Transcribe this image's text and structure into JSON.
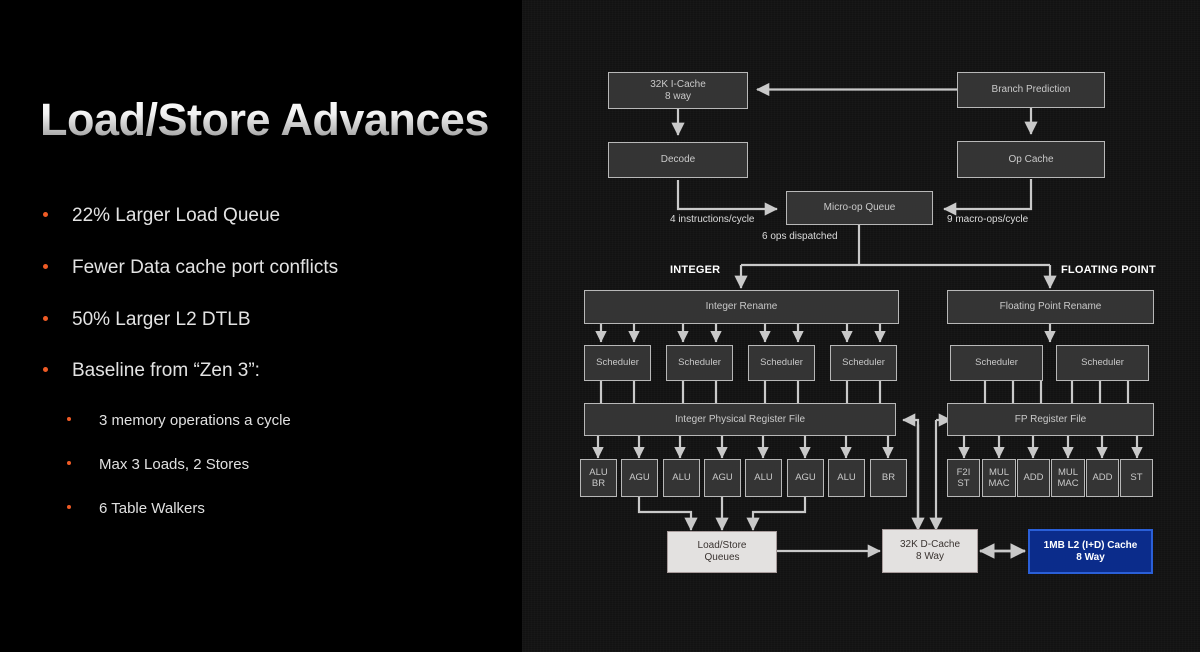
{
  "slide": {
    "title": "Load/Store Advances",
    "accent_color": "#ef5b25",
    "background_left": "#000000",
    "background_right": "#121212"
  },
  "bullets": [
    {
      "level": 1,
      "text": "22% Larger Load Queue"
    },
    {
      "level": 1,
      "text": "Fewer Data cache port conflicts"
    },
    {
      "level": 1,
      "text": "50% Larger L2 DTLB"
    },
    {
      "level": 1,
      "text": "Baseline from “Zen 3”:"
    },
    {
      "level": 2,
      "text": "3 memory operations a cycle"
    },
    {
      "level": 2,
      "text": "Max 3 Loads, 2 Stores"
    },
    {
      "level": 2,
      "text": "6 Table Walkers"
    }
  ],
  "diagram": {
    "frontend": {
      "icache": "32K I-Cache\n8 way",
      "icache_line1": "32K I-Cache",
      "icache_line2": "8 way",
      "decode": "Decode",
      "branch_prediction": "Branch Prediction",
      "op_cache": "Op Cache",
      "micro_op_queue": "Micro-op Queue"
    },
    "edge_labels": {
      "instructions_per_cycle": "4 instructions/cycle",
      "macro_ops_per_cycle": "9 macro-ops/cycle",
      "ops_dispatched": "6 ops dispatched"
    },
    "section_labels": {
      "integer": "INTEGER",
      "floating_point": "FLOATING POINT"
    },
    "integer": {
      "rename": "Integer Rename",
      "schedulers": [
        "Scheduler",
        "Scheduler",
        "Scheduler",
        "Scheduler"
      ],
      "register_file": "Integer Physical Register File",
      "units": [
        {
          "line1": "ALU",
          "line2": "BR"
        },
        {
          "line1": "AGU",
          "line2": ""
        },
        {
          "line1": "ALU",
          "line2": ""
        },
        {
          "line1": "AGU",
          "line2": ""
        },
        {
          "line1": "ALU",
          "line2": ""
        },
        {
          "line1": "AGU",
          "line2": ""
        },
        {
          "line1": "ALU",
          "line2": ""
        },
        {
          "line1": "BR",
          "line2": ""
        }
      ]
    },
    "floating_point": {
      "rename": "Floating Point Rename",
      "schedulers": [
        "Scheduler",
        "Scheduler"
      ],
      "register_file": "FP Register File",
      "units": [
        {
          "line1": "F2I",
          "line2": "ST"
        },
        {
          "line1": "MUL",
          "line2": "MAC"
        },
        {
          "line1": "ADD",
          "line2": ""
        },
        {
          "line1": "MUL",
          "line2": "MAC"
        },
        {
          "line1": "ADD",
          "line2": ""
        },
        {
          "line1": "ST",
          "line2": ""
        }
      ]
    },
    "memory": {
      "load_store_queues_line1": "Load/Store",
      "load_store_queues_line2": "Queues",
      "dcache_line1": "32K D-Cache",
      "dcache_line2": "8 Way",
      "l2cache_line1": "1MB L2 (I+D) Cache",
      "l2cache_line2": "8 Way",
      "l2_color": "#0b2c8b"
    }
  }
}
